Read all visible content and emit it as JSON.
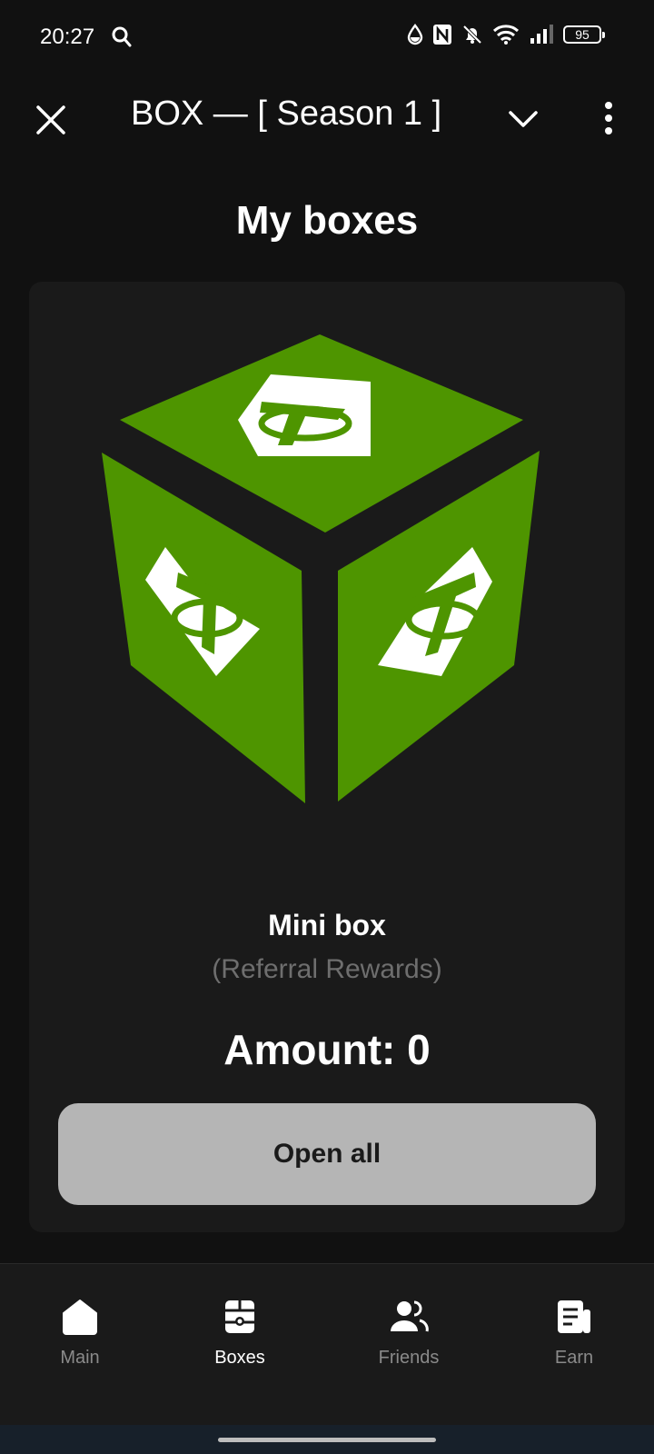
{
  "status_bar": {
    "time": "20:27",
    "battery": "95",
    "icons": [
      "search-icon",
      "drop-icon",
      "nfc-icon",
      "bell-off-icon",
      "wifi-icon",
      "signal-icon",
      "battery-icon"
    ]
  },
  "header": {
    "title": "BOX — [ Season 1 ]",
    "icons": [
      "close-icon",
      "chevron-down-icon",
      "more-vertical-icon"
    ]
  },
  "page": {
    "title": "My boxes"
  },
  "box_card": {
    "name": "Mini box",
    "subtitle": "(Referral Rewards)",
    "amount": "Amount: 0",
    "button_label": "Open all",
    "image": "green-cube-box-icon",
    "colors": {
      "cube_green": "#4e9500",
      "card_bg": "#1a1a1a",
      "button_bg": "#b5b5b5"
    }
  },
  "bottom_nav": {
    "items": [
      {
        "label": "Main",
        "icon": "home-icon",
        "active": false
      },
      {
        "label": "Boxes",
        "icon": "boxes-icon",
        "active": true
      },
      {
        "label": "Friends",
        "icon": "friends-icon",
        "active": false
      },
      {
        "label": "Earn",
        "icon": "earn-icon",
        "active": false
      }
    ]
  }
}
